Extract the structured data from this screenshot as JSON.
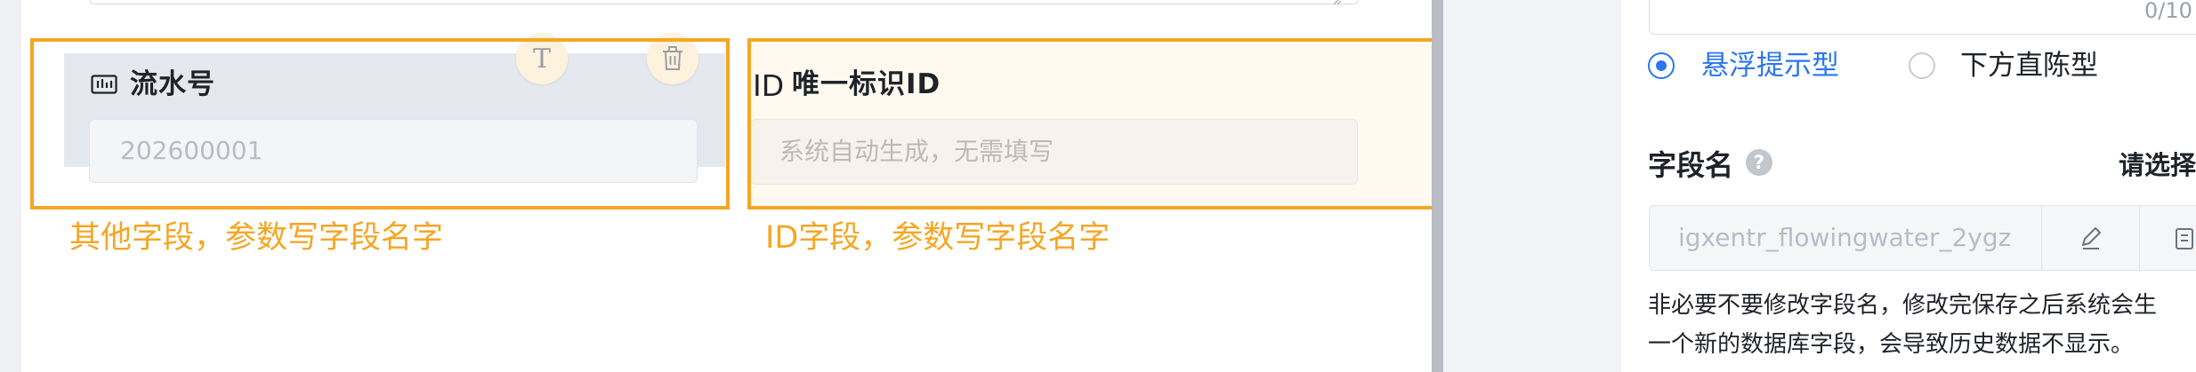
{
  "canvas": {
    "serial_field": {
      "title": "流水号",
      "value": "202600001",
      "icon": "serial-number-icon",
      "actions": [
        {
          "name": "text-format-button",
          "icon": "T"
        },
        {
          "name": "delete-button",
          "icon": "trash-icon"
        }
      ]
    },
    "id_field": {
      "glyph": "ID",
      "title": "唯一标识ID",
      "placeholder": "系统自动生成，无需填写"
    },
    "annotations": {
      "other_field": "其他字段，参数写字段名字",
      "id_field": "ID字段，参数写字段名字",
      "highlight_color": "#f5a623"
    }
  },
  "settings": {
    "top_counter": "0/10",
    "display_modes": {
      "options": [
        "悬浮提示型",
        "下方直陈型"
      ],
      "selected": "悬浮提示型"
    },
    "field_name": {
      "label": "字段名",
      "help_icon": "?",
      "select_link": "请选择",
      "value": "igxentr_flowingwater_2ygz",
      "edit_icon": "pencil-icon",
      "copy_icon": "copy-icon"
    },
    "warning": [
      "非必要不要修改字段名，修改完保存之后系统会生",
      "一个新的数据库字段，会导致历史数据不显示。"
    ]
  },
  "colors": {
    "accent_blue": "#2a76f2",
    "annotation_orange": "#f5a623",
    "text_dark": "#1f2329",
    "placeholder_gray": "#b7bcc5"
  }
}
